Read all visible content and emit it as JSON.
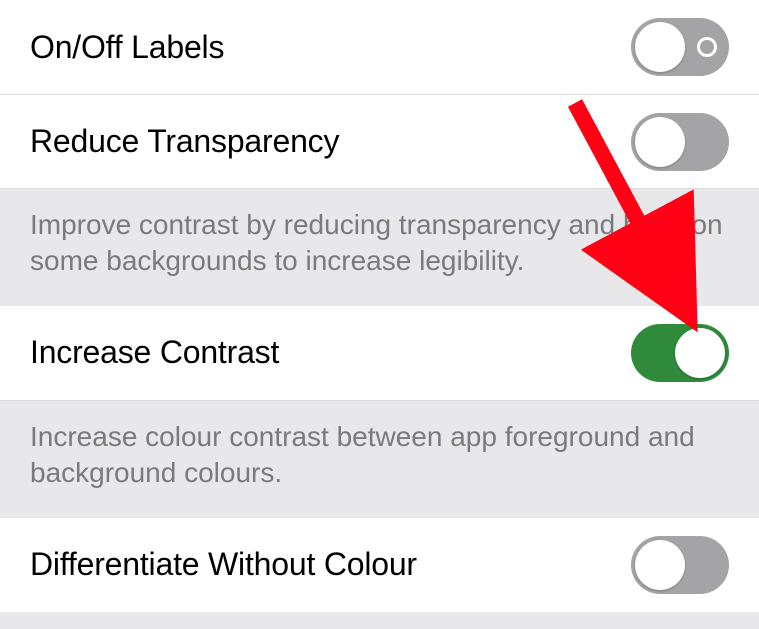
{
  "rows": {
    "onoff": {
      "label": "On/Off Labels",
      "state": "off",
      "onoff_style": true
    },
    "transparency": {
      "label": "Reduce Transparency",
      "state": "off"
    },
    "contrast": {
      "label": "Increase Contrast",
      "state": "on"
    },
    "differentiate": {
      "label": "Differentiate Without Colour",
      "state": "off"
    }
  },
  "descriptions": {
    "transparency": "Improve contrast by reducing transparency and blurs on some backgrounds to increase legibility.",
    "contrast": "Increase colour contrast between app foreground and background colours."
  },
  "colors": {
    "toggle_on": "#2f8a3c",
    "toggle_off": "#a4a4a6",
    "arrow": "#ff0014"
  }
}
